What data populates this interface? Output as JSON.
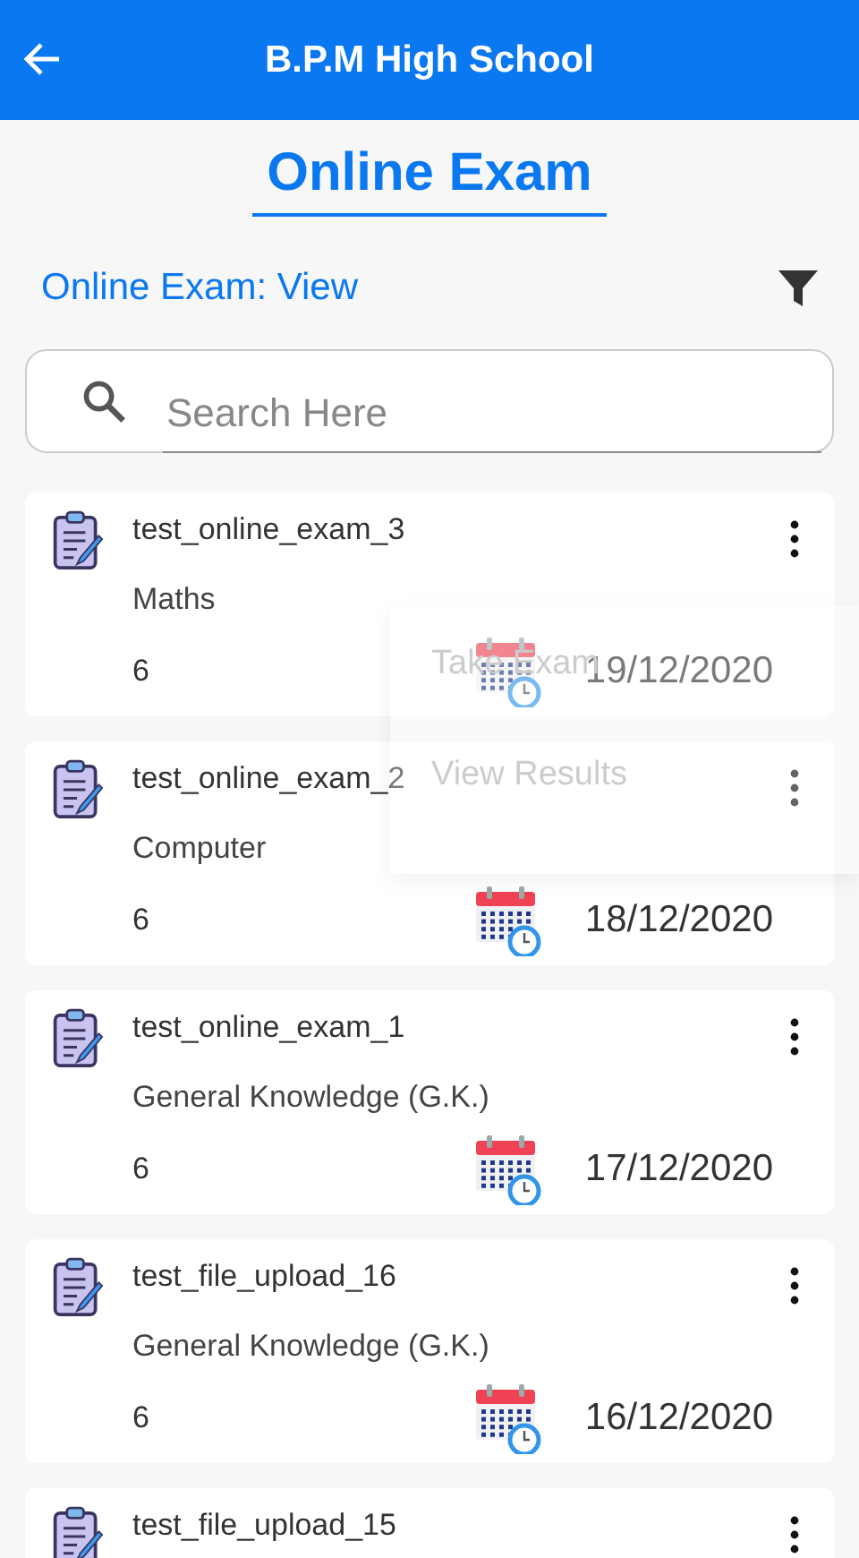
{
  "app_bar": {
    "title": "B.P.M High School"
  },
  "page_title": "Online Exam",
  "section": {
    "label": "Online Exam: View"
  },
  "search": {
    "placeholder": "Search Here"
  },
  "exams": [
    {
      "name": "test_online_exam_3",
      "subject": "Maths",
      "class": "6",
      "date": "19/12/2020"
    },
    {
      "name": "test_online_exam_2",
      "subject": "Computer",
      "class": "6",
      "date": "18/12/2020"
    },
    {
      "name": "test_online_exam_1",
      "subject": "General Knowledge (G.K.)",
      "class": "6",
      "date": "17/12/2020"
    },
    {
      "name": "test_file_upload_16",
      "subject": "General Knowledge (G.K.)",
      "class": "6",
      "date": "16/12/2020"
    },
    {
      "name": "test_file_upload_15"
    }
  ],
  "popup_menu": {
    "items": [
      "Take Exam",
      "View Results"
    ]
  }
}
